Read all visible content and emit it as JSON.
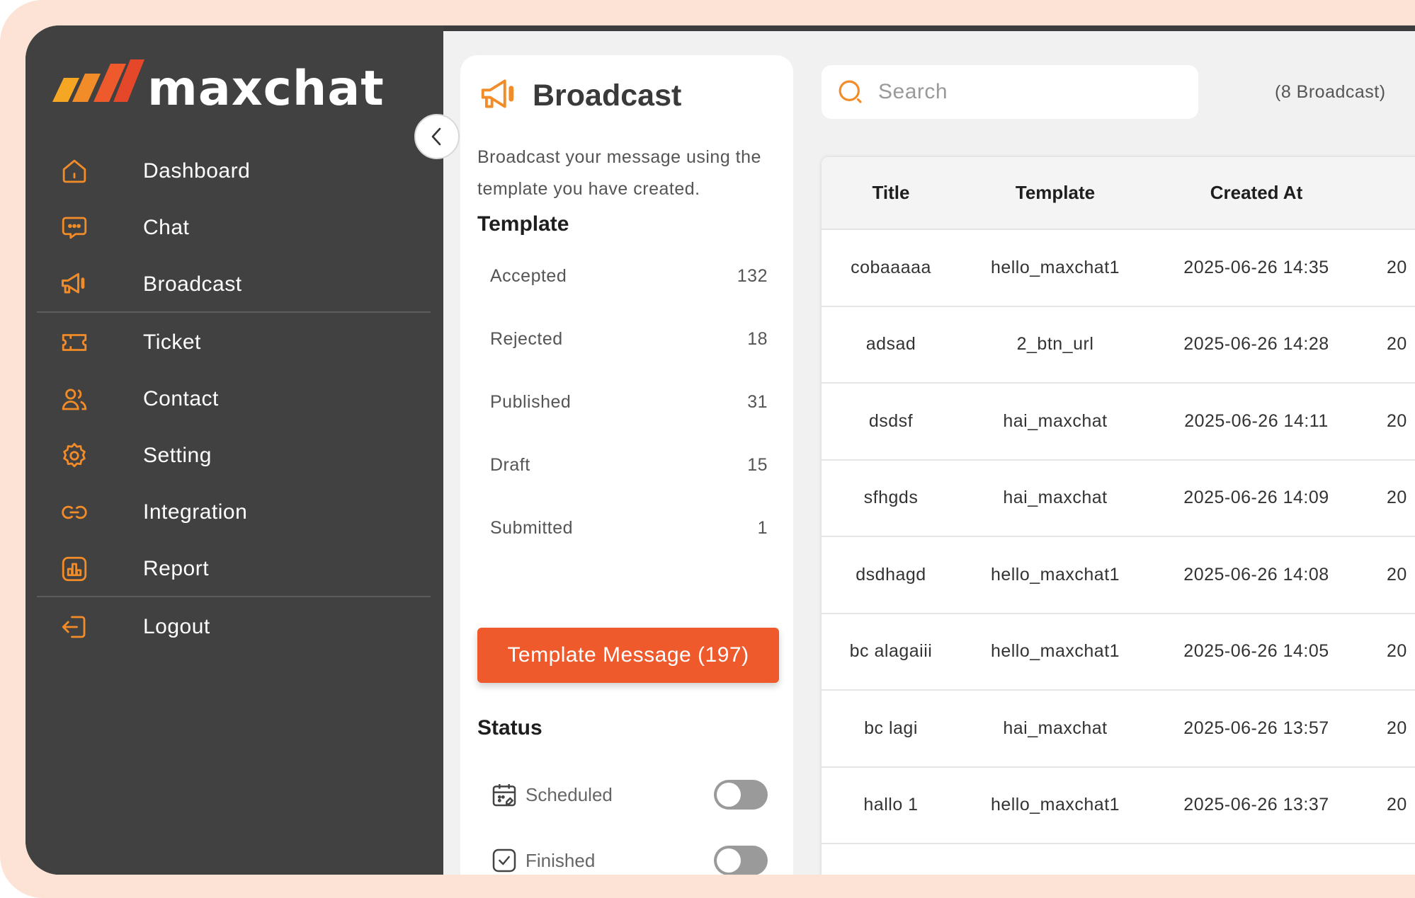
{
  "brand": {
    "name": "maxchat",
    "colors": {
      "orange": "#ee5a2c",
      "amber": "#f5a623",
      "sidebar": "#414141"
    }
  },
  "sidebar": {
    "items": [
      {
        "label": "Dashboard",
        "icon": "home-icon"
      },
      {
        "label": "Chat",
        "icon": "chat-bubble-icon"
      },
      {
        "label": "Broadcast",
        "icon": "megaphone-icon"
      },
      {
        "label": "Ticket",
        "icon": "ticket-icon"
      },
      {
        "label": "Contact",
        "icon": "users-icon"
      },
      {
        "label": "Setting",
        "icon": "gear-icon"
      },
      {
        "label": "Integration",
        "icon": "link-icon"
      },
      {
        "label": "Report",
        "icon": "report-chart-icon"
      },
      {
        "label": "Logout",
        "icon": "logout-icon"
      }
    ]
  },
  "panel": {
    "title": "Broadcast",
    "description": "Broadcast your message using the template you have created.",
    "template_heading": "Template",
    "stats": [
      {
        "label": "Accepted",
        "value": "132"
      },
      {
        "label": "Rejected",
        "value": "18"
      },
      {
        "label": "Published",
        "value": "31"
      },
      {
        "label": "Draft",
        "value": "15"
      },
      {
        "label": "Submitted",
        "value": "1"
      }
    ],
    "template_button": "Template Message (197)",
    "status_heading": "Status",
    "status": [
      {
        "label": "Scheduled",
        "icon": "calendar-icon",
        "enabled": false
      },
      {
        "label": "Finished",
        "icon": "check-square-icon",
        "enabled": false
      }
    ]
  },
  "search": {
    "placeholder": "Search",
    "value": ""
  },
  "broadcast_count": "(8 Broadcast)",
  "table": {
    "headers": [
      "Title",
      "Template",
      "Created At"
    ],
    "rows": [
      {
        "title": "cobaaaaa",
        "template": "hello_maxchat1",
        "created_at": "2025-06-26 14:35",
        "extra": "20"
      },
      {
        "title": "adsad",
        "template": "2_btn_url",
        "created_at": "2025-06-26 14:28",
        "extra": "20"
      },
      {
        "title": "dsdsf",
        "template": "hai_maxchat",
        "created_at": "2025-06-26 14:11",
        "extra": "20"
      },
      {
        "title": "sfhgds",
        "template": "hai_maxchat",
        "created_at": "2025-06-26 14:09",
        "extra": "20"
      },
      {
        "title": "dsdhagd",
        "template": "hello_maxchat1",
        "created_at": "2025-06-26 14:08",
        "extra": "20"
      },
      {
        "title": "bc alagaiii",
        "template": "hello_maxchat1",
        "created_at": "2025-06-26 14:05",
        "extra": "20"
      },
      {
        "title": "bc lagi",
        "template": "hai_maxchat",
        "created_at": "2025-06-26 13:57",
        "extra": "20"
      },
      {
        "title": "hallo 1",
        "template": "hello_maxchat1",
        "created_at": "2025-06-26 13:37",
        "extra": "20"
      }
    ]
  }
}
